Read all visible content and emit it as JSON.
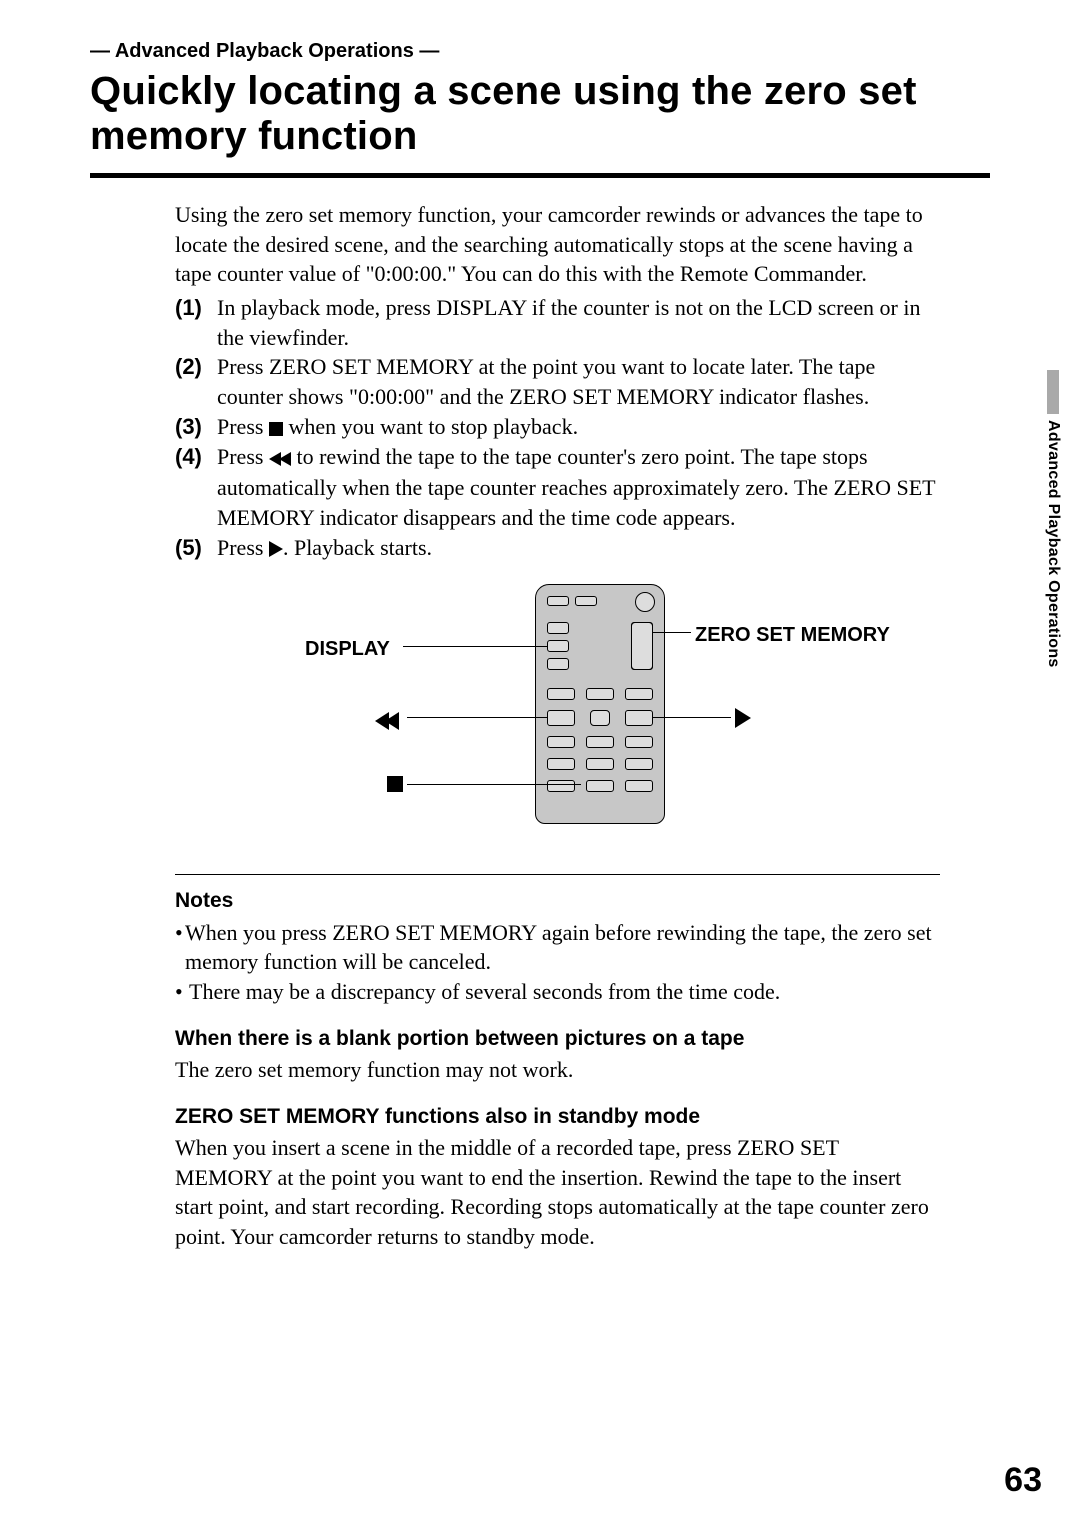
{
  "header": {
    "section_tag": "— Advanced Playback Operations —",
    "title": "Quickly locating a scene using the zero set memory function"
  },
  "intro": "Using the zero set memory function, your camcorder rewinds or advances the tape to locate the desired scene, and the searching automatically stops at the scene having a tape counter value of \"0:00:00.\" You can do this with the Remote Commander.",
  "steps": [
    {
      "num": "(1)",
      "pre": "In playback mode, press DISPLAY if the counter is not on the LCD screen or in the viewfinder.",
      "icon": "",
      "post": ""
    },
    {
      "num": "(2)",
      "pre": "Press ZERO SET MEMORY at the point you want to locate later. The tape counter shows \"0:00:00\" and the ZERO SET MEMORY indicator flashes.",
      "icon": "",
      "post": ""
    },
    {
      "num": "(3)",
      "pre": "Press ",
      "icon": "stop",
      "post": " when you want to stop playback."
    },
    {
      "num": "(4)",
      "pre": "Press ",
      "icon": "rew",
      "post": " to rewind the tape to the tape counter's zero point. The tape stops automatically when the tape counter reaches approximately zero. The ZERO SET MEMORY indicator disappears and the time code appears."
    },
    {
      "num": "(5)",
      "pre": "Press ",
      "icon": "play",
      "post": ". Playback starts."
    }
  ],
  "diagram": {
    "labels": {
      "display": "DISPLAY",
      "zero": "ZERO SET MEMORY"
    },
    "icons": {
      "rewind": "rewind-icon",
      "play": "play-icon",
      "stop": "stop-icon"
    }
  },
  "notes": {
    "heading": "Notes",
    "bullets": [
      "When you press ZERO SET MEMORY again before rewinding the tape, the zero set memory function will be canceled.",
      "There may be a discrepancy of several seconds from the time code."
    ],
    "sub1_head": "When there is a blank portion between pictures on a tape",
    "sub1_body": "The zero set memory function may not work.",
    "sub2_head": "ZERO SET MEMORY functions also in standby mode",
    "sub2_body": "When you insert a scene in the middle of a recorded tape, press ZERO SET MEMORY at the point you want to end the insertion. Rewind the tape to the insert start point, and start recording. Recording stops automatically at the tape counter zero point. Your camcorder returns to standby mode."
  },
  "side_tab": "Advanced Playback Operations",
  "page_number": "63"
}
